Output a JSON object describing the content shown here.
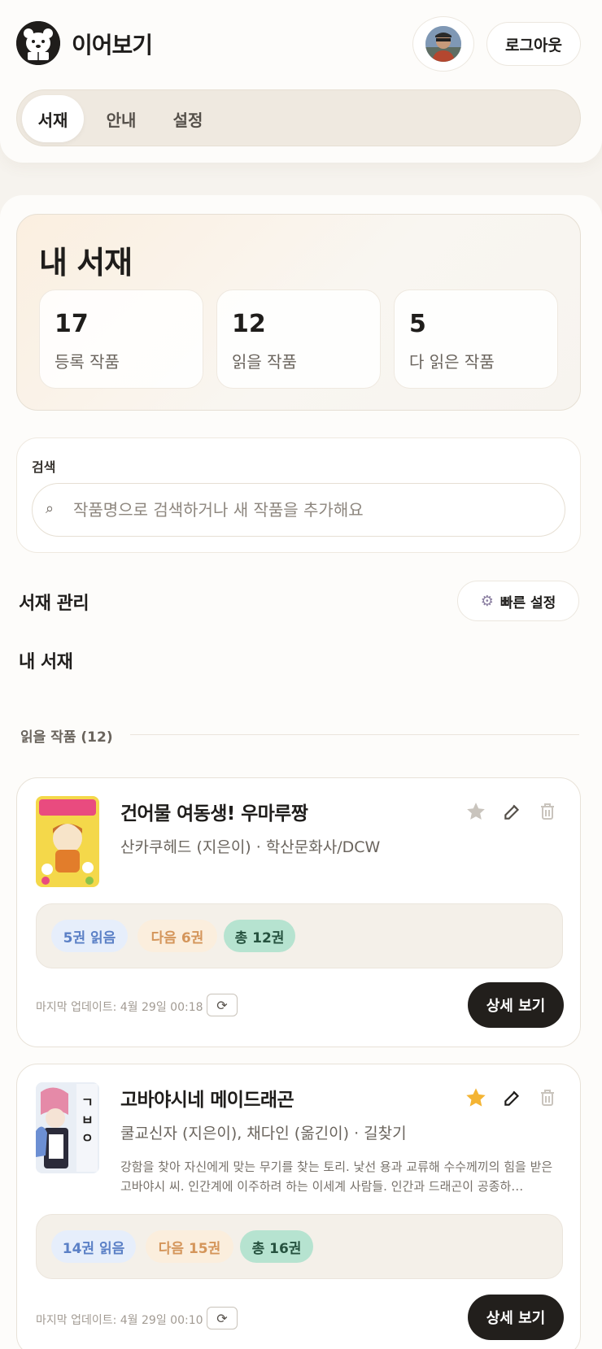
{
  "app": {
    "title": "이어보기",
    "logout_label": "로그아웃"
  },
  "tabs": [
    {
      "label": "서재",
      "active": true
    },
    {
      "label": "안내",
      "active": false
    },
    {
      "label": "설정",
      "active": false
    }
  ],
  "library": {
    "title": "내 서재",
    "stats": [
      {
        "value": "17",
        "label": "등록 작품"
      },
      {
        "value": "12",
        "label": "읽을 작품"
      },
      {
        "value": "5",
        "label": "다 읽은 작품"
      }
    ]
  },
  "search": {
    "label": "검색",
    "placeholder": "작품명으로 검색하거나 새 작품을 추가해요",
    "icon": "search-icon"
  },
  "management": {
    "title": "서재 관리",
    "quick_settings_label": "빠른 설정",
    "subtitle": "내 서재",
    "group_label": "읽을 작품 (12)"
  },
  "books": [
    {
      "title": "건어물 여동생! 우마루짱",
      "meta": "산카쿠헤드 (지은이) · 학산문화사/DCW",
      "description": "",
      "favorite": false,
      "read_label": "5권 읽음",
      "next_label": "다음 6권",
      "total_label": "총 12권",
      "updated": "마지막 업데이트: 4월 29일 00:18",
      "detail_label": "상세 보기"
    },
    {
      "title": "고바야시네 메이드래곤",
      "meta": "쿨교신자 (지은이), 채다인 (옮긴이) · 길찾기",
      "description": "강함을 찾아 자신에게 맞는 무기를 찾는 토리. 낯선 용과 교류해 수수께끼의 힘을 받은 고바야시 씨. 인간계에 이주하려 하는 이세계 사람들. 인간과 드래곤이 공종하…",
      "favorite": true,
      "read_label": "14권 읽음",
      "next_label": "다음 15권",
      "total_label": "총 16권",
      "updated": "마지막 업데이트: 4월 29일 00:10",
      "detail_label": "상세 보기"
    }
  ],
  "colors": {
    "accent_dark": "#221f1c",
    "star": "#f4b433",
    "read_pill": "#5b80c6",
    "next_pill": "#d4955a",
    "total_pill_bg": "#b6e3d0"
  }
}
